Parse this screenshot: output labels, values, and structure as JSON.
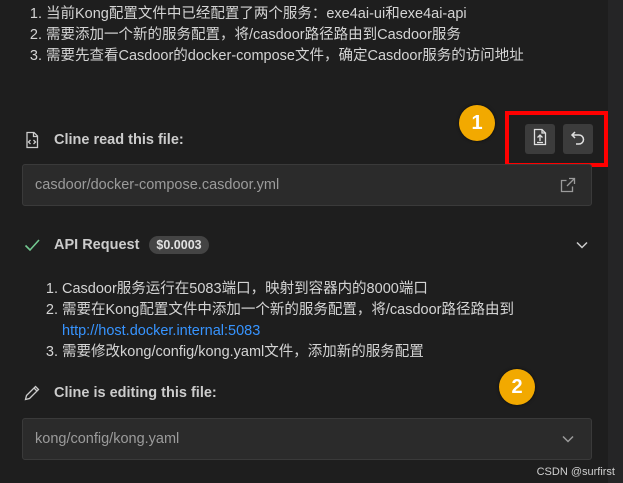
{
  "top_list": {
    "items": [
      "当前Kong配置文件中已经配置了两个服务：exe4ai-ui和exe4ai-api",
      "需要添加一个新的服务配置，将/casdoor路径路由到Casdoor服务",
      "需要先查看Casdoor的docker-compose文件，确定Casdoor服务的访问地址"
    ]
  },
  "read_section": {
    "title": "Cline read this file:",
    "file_path": "casdoor/docker-compose.casdoor.yml",
    "icon": "file-code-icon",
    "open_icon": "link-external-icon"
  },
  "toolbar": {
    "copy_icon": "copy-file-icon",
    "undo_icon": "undo-icon"
  },
  "api_request": {
    "title": "API Request",
    "cost": "$0.0003",
    "status_icon": "check-icon"
  },
  "middle_list": {
    "item1": "Casdoor服务运行在5083端口，映射到容器内的8000端口",
    "item2_text": "需要在Kong配置文件中添加一个新的服务配置，将/casdoor路径路由到",
    "item2_link": "http://host.docker.internal:5083",
    "item3": "需要修改kong/config/kong.yaml文件，添加新的服务配置"
  },
  "edit_section": {
    "title": "Cline is editing this file:",
    "file_path": "kong/config/kong.yaml",
    "icon": "pencil-icon"
  },
  "annotations": {
    "badge1": "1",
    "badge2": "2",
    "accent_color": "#f2a900",
    "highlight_color": "#ff0000"
  },
  "watermark": "CSDN @surfirst"
}
